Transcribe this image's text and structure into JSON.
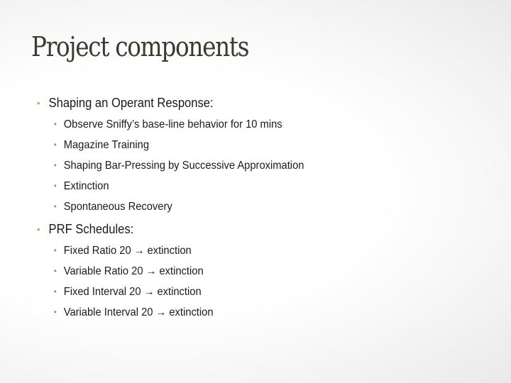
{
  "slide": {
    "title": "Project components",
    "sections": [
      {
        "heading": "Shaping an Operant Response:",
        "items": [
          "Observe Sniffy’s base-line behavior for 10 mins",
          "Magazine Training",
          "Shaping Bar-Pressing by Successive Approximation",
          "Extinction",
          "Spontaneous Recovery"
        ]
      },
      {
        "heading": "PRF Schedules:",
        "items": [
          "Fixed Ratio 20 → extinction",
          "Variable Ratio 20  → extinction",
          "Fixed Interval 20  → extinction",
          "Variable Interval 20  → extinction"
        ]
      }
    ],
    "bullet_glyph": "•",
    "colors": {
      "title": "#3b3a30",
      "level1_bullet": "#9bbb59",
      "level2_bullet": "#8c8c8c"
    }
  }
}
